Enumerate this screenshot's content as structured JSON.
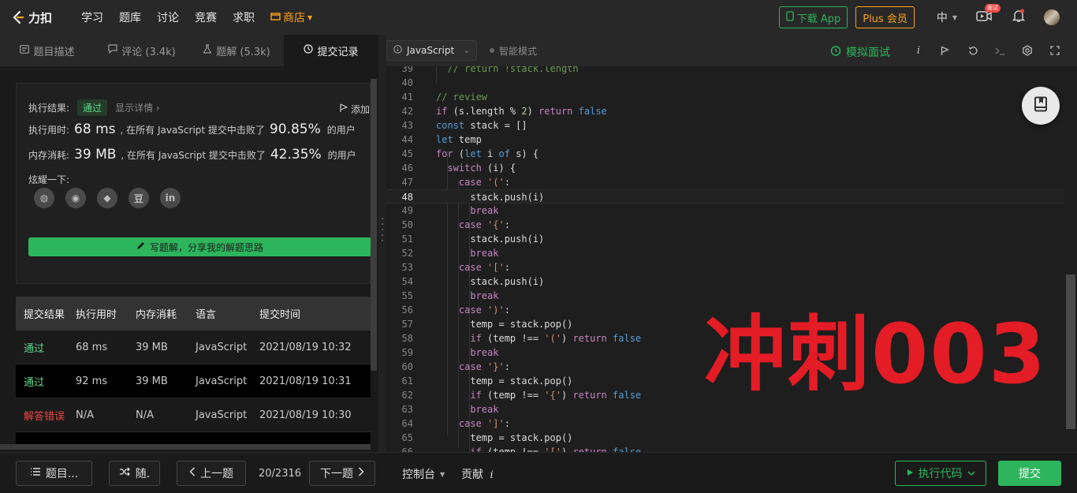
{
  "topnav": {
    "logo_text": "力扣",
    "items": [
      "学习",
      "题库",
      "讨论",
      "竞赛",
      "求职"
    ],
    "store_label": "商店",
    "download_app": "下载 App",
    "plus": "Plus 会员",
    "lang": "中",
    "badge": "面试"
  },
  "left_tabs": [
    {
      "label": "题目描述"
    },
    {
      "label": "评论 (3.4k)"
    },
    {
      "label": "题解 (5.3k)"
    },
    {
      "label": "提交记录"
    }
  ],
  "result": {
    "exec_result_label": "执行结果:",
    "status": "通过",
    "show_details": "显示详情 ›",
    "add_note": "添加",
    "time_label": "执行用时:",
    "time_value": "68 ms",
    "time_text": ", 在所有 JavaScript 提交中击败了",
    "time_pct": "90.85%",
    "users1": "的用户",
    "mem_label": "内存消耗:",
    "mem_value": "39 MB",
    "mem_text": ", 在所有 JavaScript 提交中击败了",
    "mem_pct": "42.35%",
    "users2": "的用户",
    "share_label": "炫耀一下:",
    "share_icons": [
      "wechat-icon",
      "weibo-icon",
      "qq-icon",
      "douban-icon",
      "linkedin-icon"
    ],
    "share_glyphs": [
      "◍",
      "◉",
      "◆",
      "豆",
      "in"
    ],
    "write_btn": "写题解，分享我的解题思路"
  },
  "submissions": {
    "headers": [
      "提交结果",
      "执行用时",
      "内存消耗",
      "语言",
      "提交时间"
    ],
    "rows": [
      {
        "status": "通过",
        "time": "68 ms",
        "mem": "39 MB",
        "lang": "JavaScript",
        "date": "2021/08/19 10:32"
      },
      {
        "status": "通过",
        "time": "92 ms",
        "mem": "39 MB",
        "lang": "JavaScript",
        "date": "2021/08/19 10:31"
      },
      {
        "status": "解答错误",
        "time": "N/A",
        "mem": "N/A",
        "lang": "JavaScript",
        "date": "2021/08/19 10:30"
      }
    ]
  },
  "bottom": {
    "problems": "题目...",
    "random": "随.",
    "prev": "上一题",
    "pager": "20/2316",
    "next": "下一题",
    "console": "控制台",
    "contrib": "贡献",
    "run": "执行代码",
    "submit": "提交"
  },
  "editor": {
    "language": "JavaScript",
    "smart_mode": "智能模式",
    "mock": "模拟面试",
    "current_line": 48,
    "lines": [
      {
        "n": 39,
        "text": "  // return !stack.length"
      },
      {
        "n": 40,
        "text": ""
      },
      {
        "n": 41,
        "text": "// review"
      },
      {
        "n": 42,
        "text": "if (s.length % 2) return false"
      },
      {
        "n": 43,
        "text": "const stack = []"
      },
      {
        "n": 44,
        "text": "let temp"
      },
      {
        "n": 45,
        "text": "for (let i of s) {"
      },
      {
        "n": 46,
        "text": "  switch (i) {"
      },
      {
        "n": 47,
        "text": "    case '(':"
      },
      {
        "n": 48,
        "text": "      stack.push(i)"
      },
      {
        "n": 49,
        "text": "      break"
      },
      {
        "n": 50,
        "text": "    case '{':"
      },
      {
        "n": 51,
        "text": "      stack.push(i)"
      },
      {
        "n": 52,
        "text": "      break"
      },
      {
        "n": 53,
        "text": "    case '[':"
      },
      {
        "n": 54,
        "text": "      stack.push(i)"
      },
      {
        "n": 55,
        "text": "      break"
      },
      {
        "n": 56,
        "text": "    case ')':"
      },
      {
        "n": 57,
        "text": "      temp = stack.pop()"
      },
      {
        "n": 58,
        "text": "      if (temp !== '(') return false"
      },
      {
        "n": 59,
        "text": "      break"
      },
      {
        "n": 60,
        "text": "    case '}':"
      },
      {
        "n": 61,
        "text": "      temp = stack.pop()"
      },
      {
        "n": 62,
        "text": "      if (temp !== '{') return false"
      },
      {
        "n": 63,
        "text": "      break"
      },
      {
        "n": 64,
        "text": "    case ']':"
      },
      {
        "n": 65,
        "text": "      temp = stack.pop()"
      },
      {
        "n": 66,
        "text": "      if (temp !== '[') return false"
      }
    ],
    "overlay": "冲刺003"
  },
  "colors": {
    "accent_green": "#2db55d",
    "accent_orange": "#ffa116",
    "error_red": "#ef4743",
    "overlay_red": "#e31c25"
  }
}
